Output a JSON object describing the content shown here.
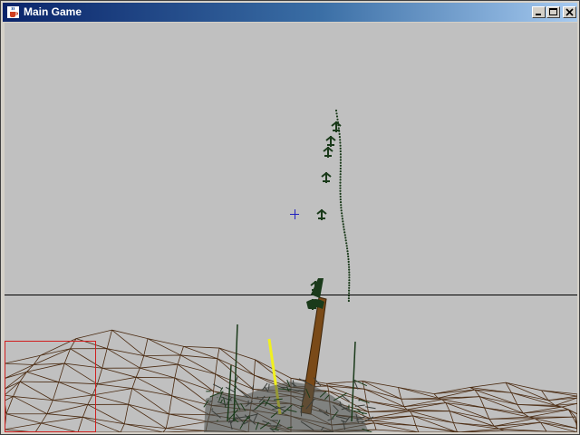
{
  "window": {
    "title": "Main Game",
    "icon": "java-cup-icon",
    "controls": [
      "minimize-icon",
      "maximize-icon",
      "close-icon"
    ]
  },
  "scene": {
    "sky_color": "#c0c0c0",
    "horizon_color": "#000000",
    "terrain_color": "#4a2a10",
    "crosshair_color": "#2020c0",
    "minimap_border_color": "#d02020",
    "laser_color": "#f0f020",
    "ship_trail_color": "#1a3a1a",
    "cannon_color": "#7a4a18"
  }
}
